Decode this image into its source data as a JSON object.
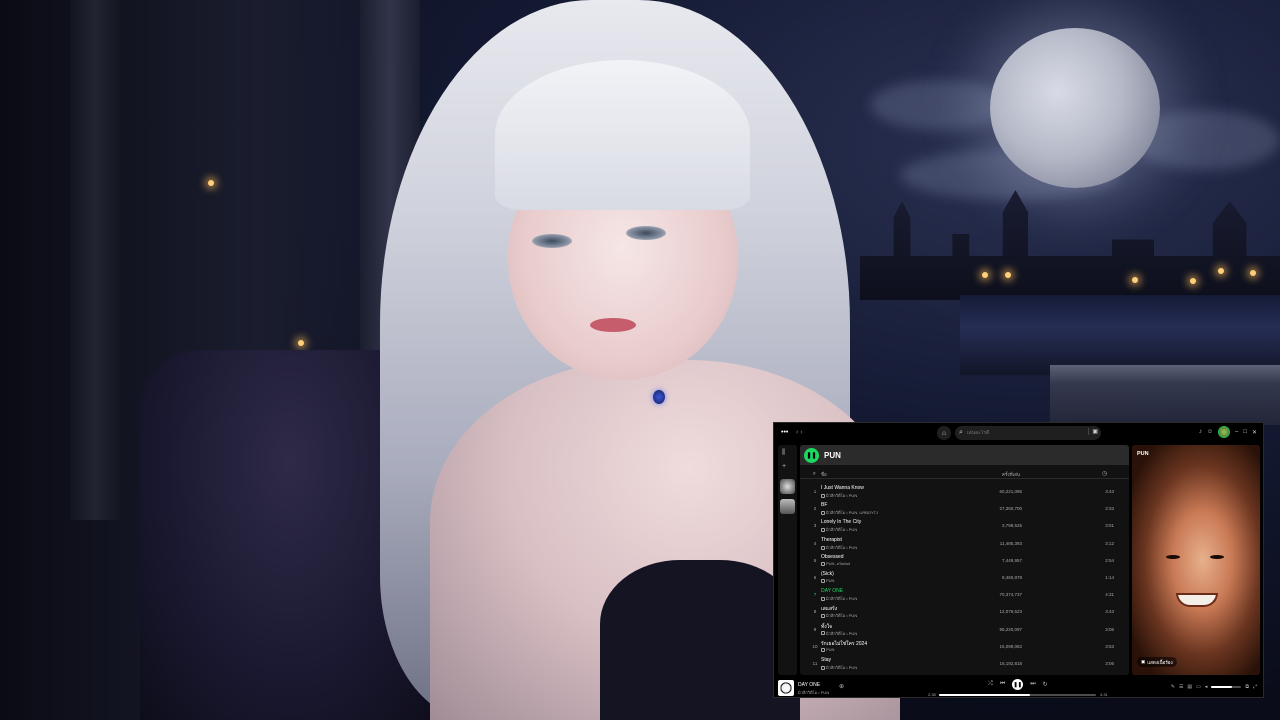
{
  "topbar": {
    "menu_icon": "ellipsis-icon",
    "search_placeholder": "เล่นอะไรดี",
    "colors": {
      "accent": "#1ed760",
      "background": "#000000",
      "panel": "#121212"
    }
  },
  "artist": {
    "name": "PUN",
    "columns": {
      "num": "#",
      "title": "ชื่อ",
      "plays": "ครั้งที่เล่น",
      "duration_icon": "clock-icon"
    }
  },
  "tracks": [
    {
      "num": "1",
      "title": "I Just Wanna Know",
      "sub": "มิวสิกวิดีโอ • PUN",
      "plays": "60,221,085",
      "duration": "3:43"
    },
    {
      "num": "2",
      "title": "BF",
      "sub": "มิวสิกวิดีโอ • PUN, URBOYTJ",
      "plays": "27,360,700",
      "duration": "3:33"
    },
    {
      "num": "3",
      "title": "Lonely In The City",
      "sub": "มิวสิกวิดีโอ • PUN",
      "plays": "3,798,525",
      "duration": "3:01"
    },
    {
      "num": "4",
      "title": "Therapist",
      "sub": "มิวสิกวิดีโอ • PUN",
      "plays": "11,485,393",
      "duration": "3:12"
    },
    {
      "num": "5",
      "title": "Obsessed",
      "sub": "PUN, aTorlad",
      "plays": "7,449,957",
      "duration": "2:54"
    },
    {
      "num": "6",
      "title": "(Sick)",
      "sub": "PUN",
      "plays": "8,460,878",
      "duration": "1:14"
    },
    {
      "num": "7",
      "title": "DAY ONE",
      "sub": "มิวสิกวิดีโอ • PUN",
      "plays": "70,374,737",
      "duration": "4:31",
      "active": true
    },
    {
      "num": "8",
      "title": "เสแสร้ง",
      "sub": "มิวสิกวิดีโอ • PUN",
      "plays": "12,079,523",
      "duration": "3:43"
    },
    {
      "num": "9",
      "title": "ทั้งใจ",
      "sub": "มิวสิกวิดีโอ • PUN",
      "plays": "95,220,097",
      "duration": "3:06"
    },
    {
      "num": "10",
      "title": "รักเธอไม่ใช่ใคร 2024",
      "sub": "PUN",
      "plays": "15,099,082",
      "duration": "3:53"
    },
    {
      "num": "11",
      "title": "Stay",
      "sub": "มิวสิกวิดีโอ • PUN",
      "plays": "15,192,818",
      "duration": "3:06"
    }
  ],
  "now_playing_panel": {
    "title": "PUN",
    "lyrics_button": "แสดงเนื้อร้อง"
  },
  "player": {
    "title": "DAY ONE",
    "subtitle": "มิวสิกวิดีโอ • PUN",
    "elapsed": "2:38",
    "total": "4:31",
    "progress": 0.58,
    "volume": 0.7
  }
}
